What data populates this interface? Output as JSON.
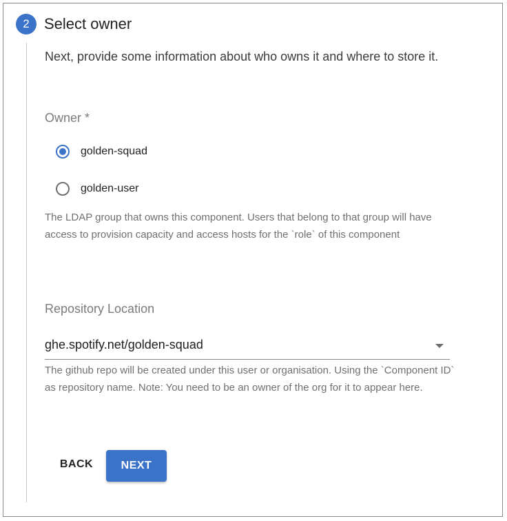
{
  "step": {
    "number": "2",
    "title": "Select owner"
  },
  "intro_text": "Next, provide some information about who owns it and where to store it.",
  "owner": {
    "label": "Owner *",
    "options": [
      {
        "label": "golden-squad",
        "checked": true
      },
      {
        "label": "golden-user",
        "checked": false
      }
    ],
    "helper_text": "The LDAP group that owns this component. Users that belong to that group will have access to provision capacity and access hosts for the `role` of this component"
  },
  "repository": {
    "label": "Repository Location",
    "value": "ghe.spotify.net/golden-squad",
    "helper_text": "The github repo will be created under this user or organisation. Using the `Component ID` as repository name. Note: You need to be an owner of the org for it to appear here."
  },
  "actions": {
    "back_label": "BACK",
    "next_label": "NEXT"
  },
  "colors": {
    "accent": "#3b73c9"
  }
}
